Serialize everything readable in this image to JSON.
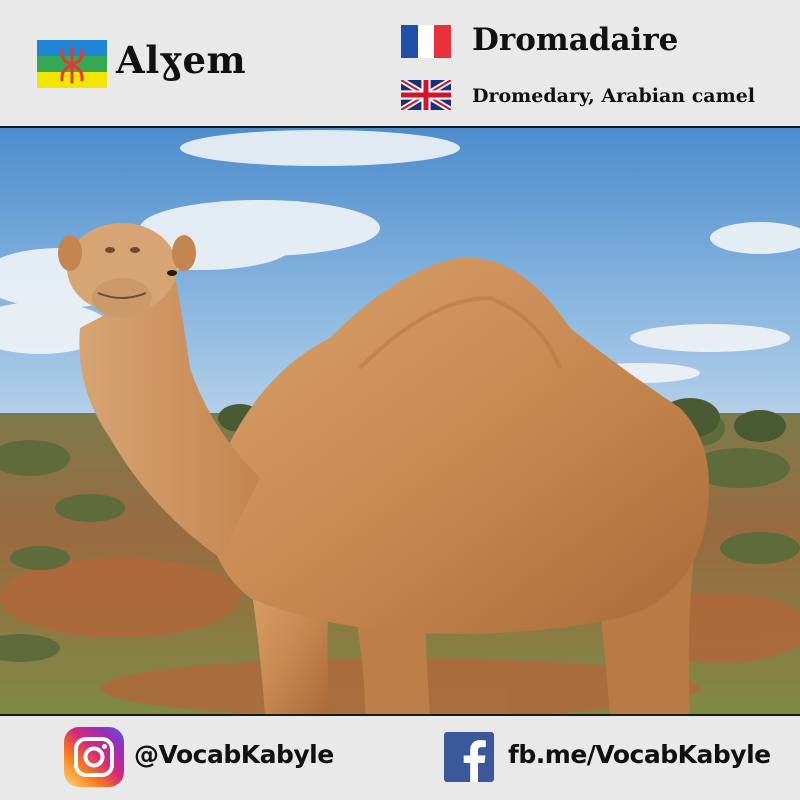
{
  "header": {
    "kabyle_word": "Alɣem",
    "french_word": "Dromadaire",
    "english_word": "Dromedary, Arabian camel"
  },
  "footer": {
    "instagram_handle": "@VocabKabyle",
    "facebook_link": "fb.me/VocabKabyle"
  },
  "icons": {
    "kabyle_flag": "amazigh-flag-icon",
    "french_flag": "france-flag-icon",
    "english_flag": "uk-flag-icon",
    "instagram": "instagram-icon",
    "facebook": "facebook-icon"
  },
  "colors": {
    "header_bg": "#e9e9e9",
    "sky": "#6ea6d8",
    "camel": "#c98a52",
    "instagram_gradient": [
      "#feda75",
      "#fa7e1e",
      "#d62976",
      "#962fbf",
      "#4f5bd5"
    ],
    "facebook_blue": "#3b5998"
  }
}
